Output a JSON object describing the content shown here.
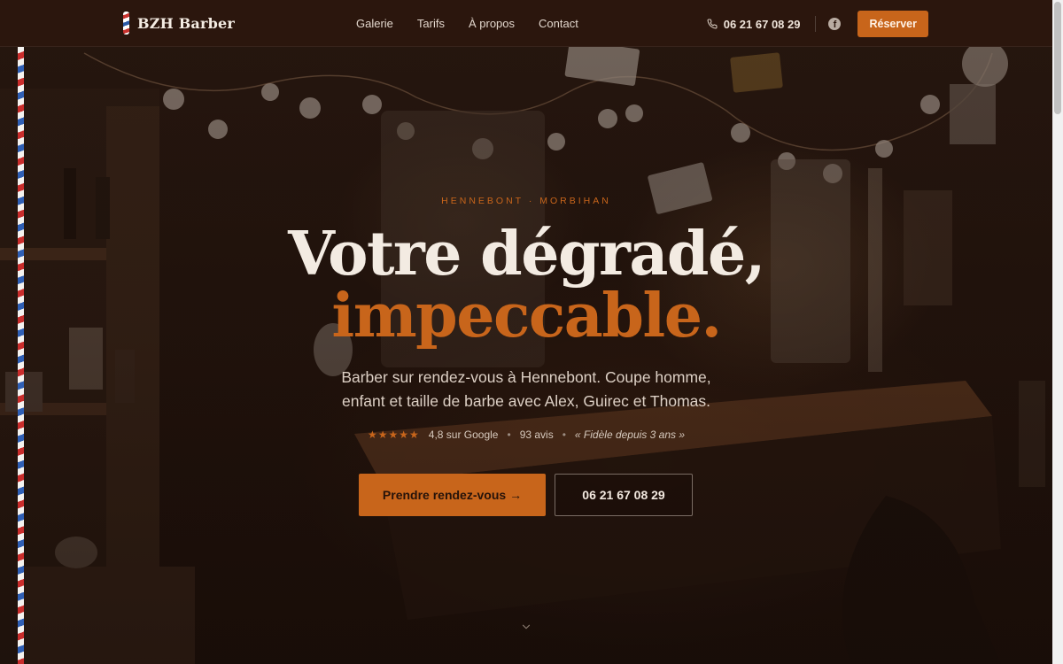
{
  "nav": {
    "brand": "BZH Barber",
    "links": [
      "Galerie",
      "Tarifs",
      "À propos",
      "Contact"
    ],
    "phone": "06 21 67 08 29",
    "phone_icon": "phone-icon",
    "social_icon": "facebook-icon",
    "reserve_label": "Réserver"
  },
  "hero": {
    "eyebrow": "HENNEBONT · MORBIHAN",
    "title_line1": "Votre dégradé,",
    "title_line2": "impeccable.",
    "lead_line1": "Barber sur rendez-vous à Hennebont. Coupe homme,",
    "lead_line2": "enfant et taille de barbe avec Alex, Guirec et Thomas.",
    "stars": "★★★★★",
    "rating_text": "4,8 sur Google",
    "reviews": "93 avis",
    "quote": "« Fidèle depuis 3 ans »",
    "cta_primary": "Prendre rendez-vous →",
    "cta_secondary": "06 21 67 08 29",
    "scroll_icon": "chevron-down-icon"
  },
  "colors": {
    "accent": "#c8651b",
    "nav_bg": "#2b160d",
    "text": "#f3ebe2"
  }
}
